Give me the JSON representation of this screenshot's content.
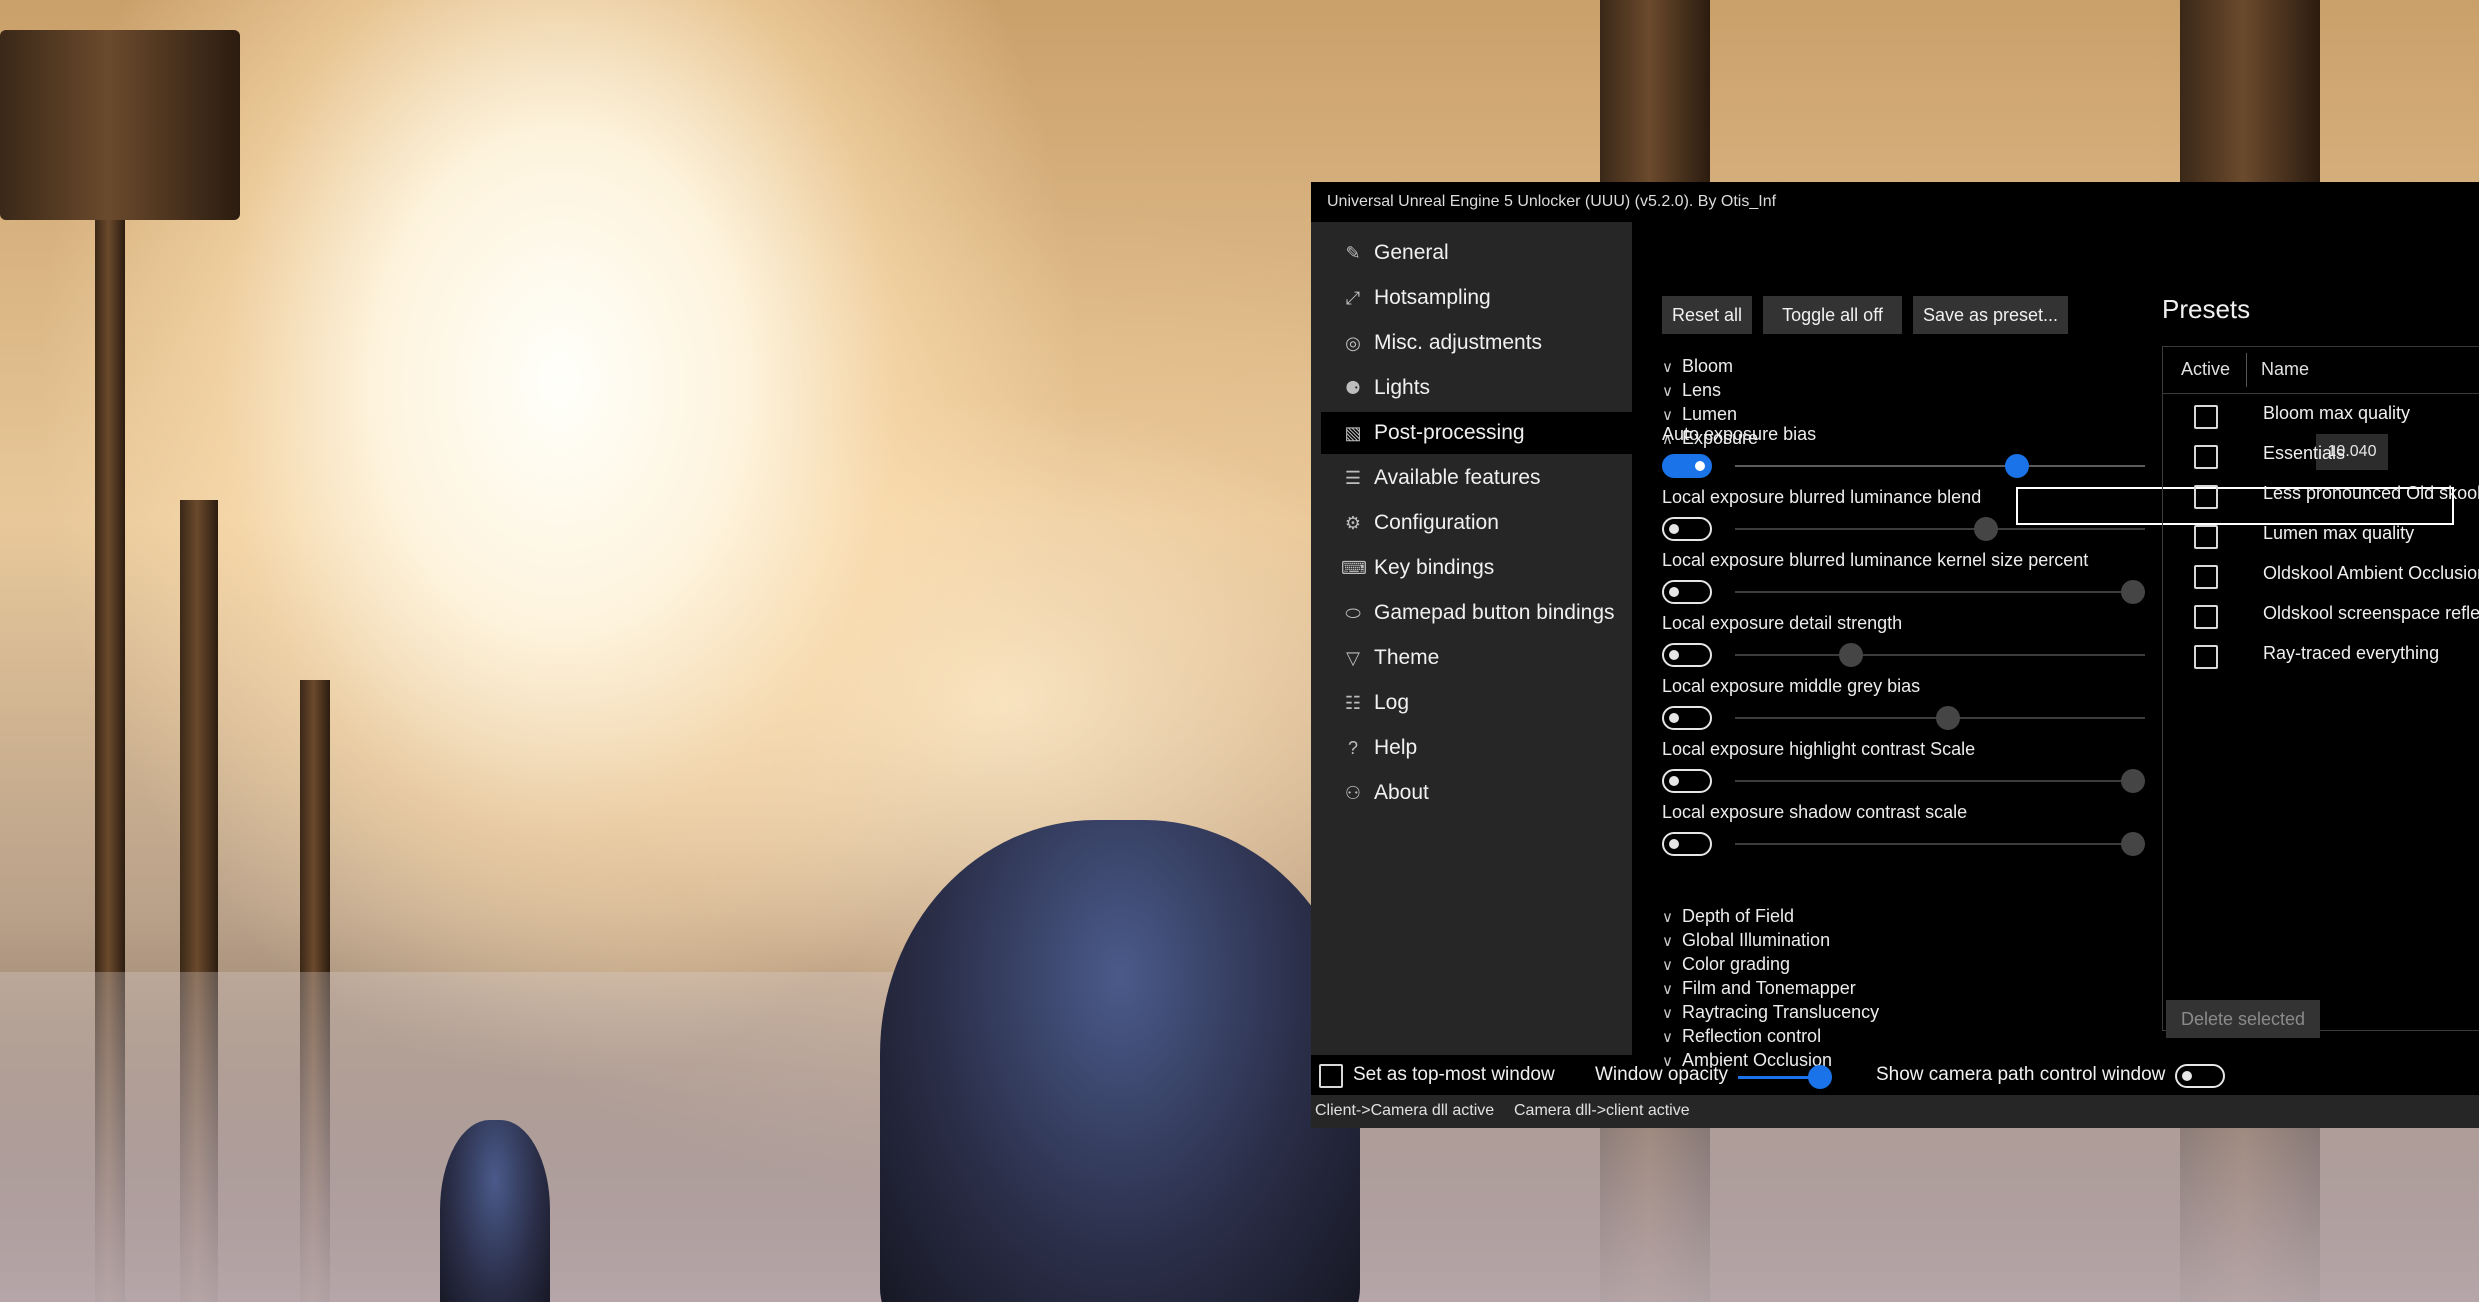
{
  "window": {
    "title": "Universal Unreal Engine 5 Unlocker (UUU) (v5.2.0). By Otis_Inf"
  },
  "sidebar": {
    "items": [
      {
        "label": "General",
        "icon": "pencil-icon"
      },
      {
        "label": "Hotsampling",
        "icon": "resize-arrow-icon"
      },
      {
        "label": "Misc. adjustments",
        "icon": "globe-icon"
      },
      {
        "label": "Lights",
        "icon": "lightbulb-icon"
      },
      {
        "label": "Post-processing",
        "icon": "image-edit-icon",
        "selected": true
      },
      {
        "label": "Available features",
        "icon": "list-icon"
      },
      {
        "label": "Configuration",
        "icon": "gear-icon"
      },
      {
        "label": "Key bindings",
        "icon": "keyboard-icon"
      },
      {
        "label": "Gamepad button bindings",
        "icon": "gamepad-icon"
      },
      {
        "label": "Theme",
        "icon": "paint-brush-icon"
      },
      {
        "label": "Log",
        "icon": "document-icon"
      },
      {
        "label": "Help",
        "icon": "question-icon"
      },
      {
        "label": "About",
        "icon": "person-icon"
      }
    ]
  },
  "toolbar": {
    "reset_all": "Reset all",
    "toggle_all_off": "Toggle all off",
    "save_as_preset": "Save as preset..."
  },
  "sections_top": [
    {
      "label": "Bloom",
      "expanded": false
    },
    {
      "label": "Lens",
      "expanded": false
    },
    {
      "label": "Lumen",
      "expanded": false
    },
    {
      "label": "Exposure",
      "expanded": true
    }
  ],
  "exposure_params": [
    {
      "label": "Auto exposure bias",
      "enabled": true,
      "slider": 0.7
    },
    {
      "label": "Local exposure blurred luminance blend",
      "enabled": false,
      "slider": 0.62
    },
    {
      "label": "Local exposure blurred luminance kernel size percent",
      "enabled": false,
      "slider": 1.0
    },
    {
      "label": "Local exposure detail strength",
      "enabled": false,
      "slider": 0.27
    },
    {
      "label": "Local exposure middle grey bias",
      "enabled": false,
      "slider": 0.52
    },
    {
      "label": "Local exposure highlight contrast Scale",
      "enabled": false,
      "slider": 1.0
    },
    {
      "label": "Local exposure shadow contrast scale",
      "enabled": false,
      "slider": 1.0
    }
  ],
  "tooltip_value": "10.040",
  "sections_bottom": [
    {
      "label": "Depth of Field"
    },
    {
      "label": "Global Illumination"
    },
    {
      "label": "Color grading"
    },
    {
      "label": "Film and Tonemapper"
    },
    {
      "label": "Raytracing Translucency"
    },
    {
      "label": "Reflection control"
    },
    {
      "label": "Ambient Occlusion"
    }
  ],
  "presets": {
    "title": "Presets",
    "col_active": "Active",
    "col_name": "Name",
    "rows": [
      {
        "name": "Bloom max quality",
        "active": false
      },
      {
        "name": "Essentials",
        "active": false
      },
      {
        "name": "Less pronounced Old skool",
        "active": false
      },
      {
        "name": "Lumen max quality",
        "active": false
      },
      {
        "name": "Oldskool Ambient Occlusion",
        "active": false
      },
      {
        "name": "Oldskool screenspace reflections",
        "active": false
      },
      {
        "name": "Ray-traced everything",
        "active": false
      }
    ],
    "delete_selected": "Delete selected"
  },
  "bottom": {
    "topmost_label": "Set as top-most window",
    "topmost_checked": false,
    "opacity_label": "Window opacity",
    "opacity_value": 1.0,
    "camera_path_label": "Show camera path control window",
    "camera_path_enabled": false
  },
  "status": {
    "client_camera": "Client->Camera dll active",
    "camera_client": "Camera dll->client active"
  },
  "colors": {
    "accent": "#1a73e8",
    "window_bg": "#000000",
    "sidebar_bg": "#262626"
  }
}
